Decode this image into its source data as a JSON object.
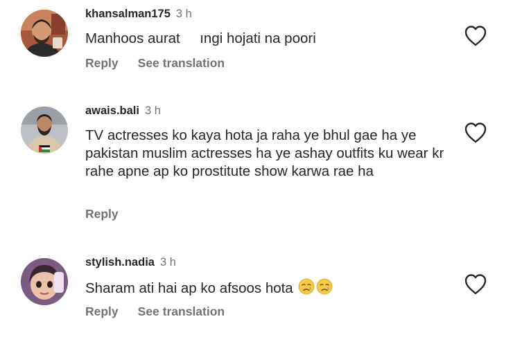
{
  "comments": [
    {
      "username": "khansalman175",
      "time": "3 h",
      "text": "Manhoos aurat     ıngi hojati na poori",
      "reply_label": "Reply",
      "translate_label": "See translation"
    },
    {
      "username": "awais.bali",
      "time": "3 h",
      "text": "TV actresses ko kaya hota ja raha ye bhul gae ha ye pakistan muslim actresses ha ye ashay outfits ku wear kr rahe apne ap ko prostitute show karwa rae ha",
      "reply_label": "Reply"
    },
    {
      "username": "stylish.nadia",
      "time": "3 h",
      "text": "Sharam ati hai ap ko afsoos hota",
      "emoji": [
        "crying-face",
        "crying-face"
      ],
      "reply_label": "Reply",
      "translate_label": "See translation"
    }
  ],
  "icons": {
    "like": "heart-outline-icon",
    "emoji": "crying-face-emoji"
  },
  "colors": {
    "primary_text": "#262626",
    "secondary_text": "#737373",
    "icon": "#262626",
    "emoji_yellow": "#f7c948",
    "tear_blue": "#5aa9e6"
  }
}
